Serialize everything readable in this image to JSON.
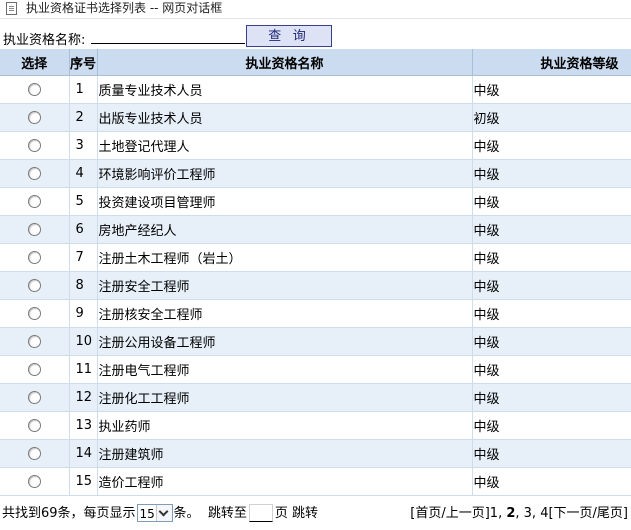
{
  "window": {
    "title": "执业资格证书选择列表 -- 网页对话框",
    "icon": "document-icon"
  },
  "search": {
    "label": "执业资格名称:",
    "value": "",
    "button_label": "查 询"
  },
  "table": {
    "headers": {
      "select": "选择",
      "no": "序号",
      "name": "执业资格名称",
      "level": "执业资格等级"
    },
    "rows": [
      {
        "no": "1",
        "name": "质量专业技术人员",
        "level": "中级"
      },
      {
        "no": "2",
        "name": "出版专业技术人员",
        "level": "初级"
      },
      {
        "no": "3",
        "name": "土地登记代理人",
        "level": "中级"
      },
      {
        "no": "4",
        "name": "环境影响评价工程师",
        "level": "中级"
      },
      {
        "no": "5",
        "name": "投资建设项目管理师",
        "level": "中级"
      },
      {
        "no": "6",
        "name": "房地产经纪人",
        "level": "中级"
      },
      {
        "no": "7",
        "name": "注册土木工程师（岩土）",
        "level": "中级"
      },
      {
        "no": "8",
        "name": "注册安全工程师",
        "level": "中级"
      },
      {
        "no": "9",
        "name": "注册核安全工程师",
        "level": "中级"
      },
      {
        "no": "10",
        "name": "注册公用设备工程师",
        "level": "中级"
      },
      {
        "no": "11",
        "name": "注册电气工程师",
        "level": "中级"
      },
      {
        "no": "12",
        "name": "注册化工工程师",
        "level": "中级"
      },
      {
        "no": "13",
        "name": "执业药师",
        "level": "中级"
      },
      {
        "no": "14",
        "name": "注册建筑师",
        "level": "中级"
      },
      {
        "no": "15",
        "name": "造价工程师",
        "level": "中级"
      }
    ]
  },
  "footer": {
    "total_text": "共找到69条，每页显示",
    "page_size": "15",
    "unit_text": "条。",
    "jump_label": "跳转至",
    "jump_value": "",
    "page_unit": "页",
    "jump_button": "跳转",
    "first_prev": "[首页/上一页]",
    "pages": [
      {
        "label": "1",
        "current": false,
        "sep": ", "
      },
      {
        "label": "2",
        "current": true,
        "sep": ", "
      },
      {
        "label": "3",
        "current": false,
        "sep": ", "
      },
      {
        "label": "4",
        "current": false,
        "sep": ""
      }
    ],
    "next_last": "[下一页/尾页]"
  },
  "colors": {
    "header_bg": "#ccdcf0",
    "row_alt_bg": "#e7eff8",
    "button_bg": "#dde2f4",
    "button_border": "#39418c"
  }
}
